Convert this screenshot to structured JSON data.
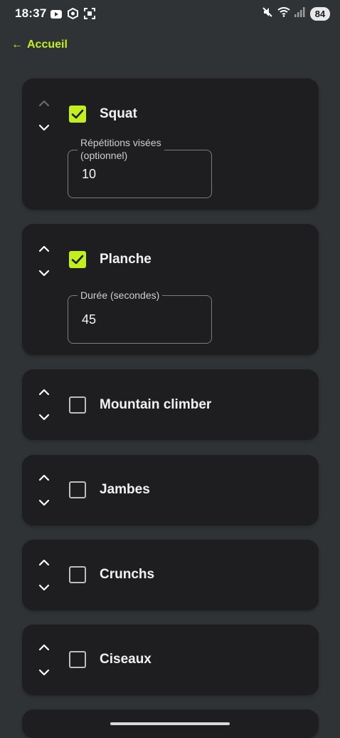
{
  "status_bar": {
    "time": "18:37",
    "battery": "84",
    "left_icons": [
      "youtube-icon",
      "hexagon-app-icon",
      "screen-record-icon"
    ],
    "right_icons": [
      "mute-icon",
      "wifi-icon",
      "signal-icon"
    ]
  },
  "nav": {
    "back_arrow": "←",
    "back_label": "Accueil"
  },
  "accent_color": "#c3ef1e",
  "exercises": [
    {
      "name": "Squat",
      "checked": true,
      "field": {
        "label_line1": "Répétitions visées",
        "label_line2": "(optionnel)",
        "value": "10"
      }
    },
    {
      "name": "Planche",
      "checked": true,
      "field": {
        "label": "Durée (secondes)",
        "value": "45"
      }
    },
    {
      "name": "Mountain climber",
      "checked": false
    },
    {
      "name": "Jambes",
      "checked": false
    },
    {
      "name": "Crunchs",
      "checked": false
    },
    {
      "name": "Ciseaux",
      "checked": false
    }
  ]
}
